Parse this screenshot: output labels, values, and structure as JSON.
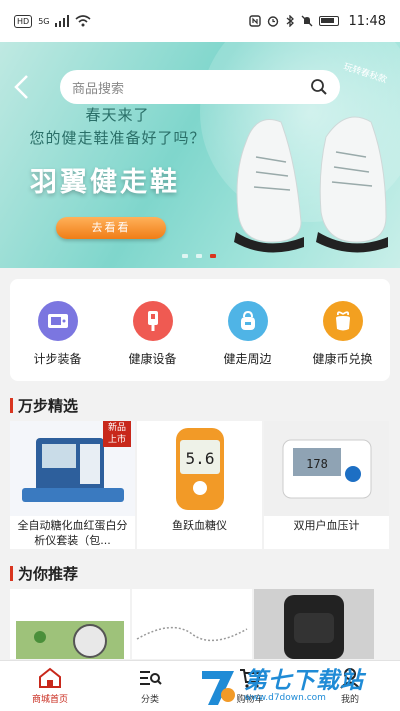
{
  "status_bar": {
    "left_box": "HD",
    "network": "5G",
    "time": "11:48",
    "left_indicators": [
      "hd-icon",
      "signal-icon",
      "wifi-icon"
    ],
    "right_indicators": [
      "nfc-icon",
      "alarm-icon",
      "bluetooth-icon",
      "mute-icon",
      "battery-icon"
    ]
  },
  "banner": {
    "search_placeholder": "商品搜索",
    "corner_tag": "玩转春秋款",
    "line1": "春天来了",
    "line2": "您的健走鞋准备好了吗？",
    "title": "羽翼健走鞋",
    "cta": "去看看",
    "dots": 3,
    "active_dot": 2
  },
  "categories": [
    {
      "label": "计步装备",
      "icon": "pedometer-icon",
      "color": "#7b76e0"
    },
    {
      "label": "健康设备",
      "icon": "thermometer-icon",
      "color": "#ef5a52"
    },
    {
      "label": "健走周边",
      "icon": "backpack-icon",
      "color": "#4fb4e6"
    },
    {
      "label": "健康币兑换",
      "icon": "gift-icon",
      "color": "#f3a020"
    }
  ],
  "section_wanbu": {
    "title": "万步精选"
  },
  "products": [
    {
      "name": "全自动糖化血红蛋白分析仪套装（包...",
      "badge": "新品上市",
      "img_bg": "#f4f6fa"
    },
    {
      "name": "鱼跃血糖仪",
      "badge": "",
      "img_bg": "#ffffff"
    },
    {
      "name": "双用户血压计",
      "badge": "",
      "img_bg": "#f0f0f0"
    }
  ],
  "section_rec": {
    "title": "为你推荐"
  },
  "tabs": [
    {
      "label": "商城首页",
      "icon": "home-icon",
      "active": true
    },
    {
      "label": "分类",
      "icon": "category-icon",
      "active": false
    },
    {
      "label": "购物车",
      "icon": "cart-icon",
      "active": false
    },
    {
      "label": "我的",
      "icon": "user-icon",
      "active": false
    }
  ],
  "watermark": {
    "text": "第七下载站",
    "url": "www.d7down.com"
  }
}
